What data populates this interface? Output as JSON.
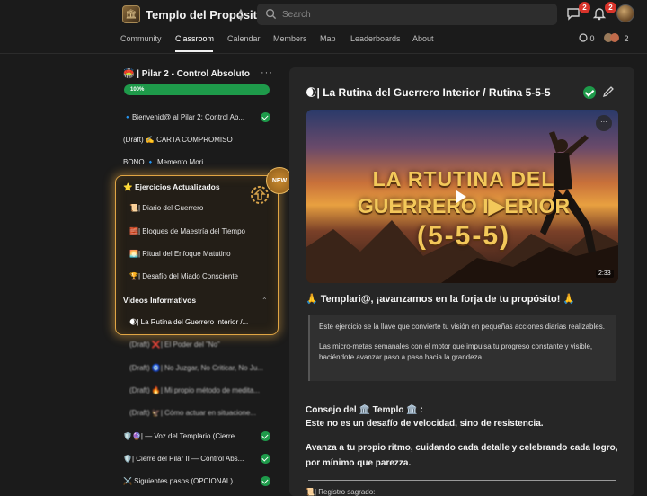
{
  "header": {
    "site_title": "Templo del Propósito",
    "search_placeholder": "Search",
    "chat_badge": "2",
    "notifications_badge": "2"
  },
  "nav": {
    "tabs": [
      "Community",
      "Classroom",
      "Calendar",
      "Members",
      "Map",
      "Leaderboards",
      "About"
    ],
    "active": "Classroom",
    "online_count": "0",
    "members_count": "2"
  },
  "sidebar": {
    "module_title": "🏟️ | Pilar 2 - Control Absoluto",
    "progress_percent": 100,
    "progress_label": "100%",
    "items": [
      {
        "label": "🔹Bienvenid@ al Pilar 2: Control Ab...",
        "done": true
      },
      {
        "label": "(Draft) ✍️ CARTA COMPROMISO",
        "done": false
      },
      {
        "label": "BONO 🔹 Memento Mori",
        "done": false
      }
    ],
    "section_ejercicios": "⭐ Ejercicios Actualizados",
    "new_badge": "NEW",
    "ejercicios": [
      {
        "label": "📜| Diario del Guerrero"
      },
      {
        "label": "🧱| Bloques de Maestría del Tiempo"
      },
      {
        "label": "🌅| Ritual del Enfoque Matutino"
      },
      {
        "label": "🏆| Desafío del Miado Consciente"
      }
    ],
    "section_videos": "Videos Informativos",
    "videos": [
      {
        "label": "🌒| La Rutina del Guerrero Interior /..."
      },
      {
        "label": "(Draft) ❌| El Poder del \"No\""
      },
      {
        "label": "(Draft) 🧿| No Juzgar, No Criticar, No Ju..."
      },
      {
        "label": "(Draft) 🔥| Mi propio método de medita..."
      },
      {
        "label": "(Draft) 🦅| Cómo actuar en situacione..."
      }
    ],
    "footer_items": [
      {
        "label": "🛡️🔮| — Voz del Templario (Cierre ...",
        "done": true
      },
      {
        "label": "🛡️| Cierre del Pilar II — Control Abs...",
        "done": true
      },
      {
        "label": "⚔️ Siguientes pasos (OPCIONAL)",
        "done": true
      }
    ]
  },
  "lesson": {
    "title": "🌒| La Rutina del Guerrero Interior / Rutina 5-5-5",
    "video_title_line1": "LA RTUTINA DEL",
    "video_title_line2": "GUERRERO I▶ERIOR",
    "video_title_line3": "(5-5-5)",
    "video_duration": "2:33",
    "headline": "🙏 Templari@, ¡avanzamos en la forja de tu propósito! 🙏",
    "quote_p1": "Este ejercicio se la llave que convierte tu visión en pequeñas acciones diarias realizables.",
    "quote_p2": "Las micro-metas semanales con el motor que impulsa tu progreso constante y visible, haciéndote avanzar paso a paso hacia la grandeza.",
    "consejo": "Consejo del 🏛️ Templo 🏛️ :",
    "consejo_sub": "Este no es un desafío de velocidad, sino de resistencia.",
    "advice": "Avanza a tu propio ritmo, cuidando cada detalle y celebrando cada logro, por mínimo que parezza.",
    "registro": "📜| Registro sagrado:"
  }
}
